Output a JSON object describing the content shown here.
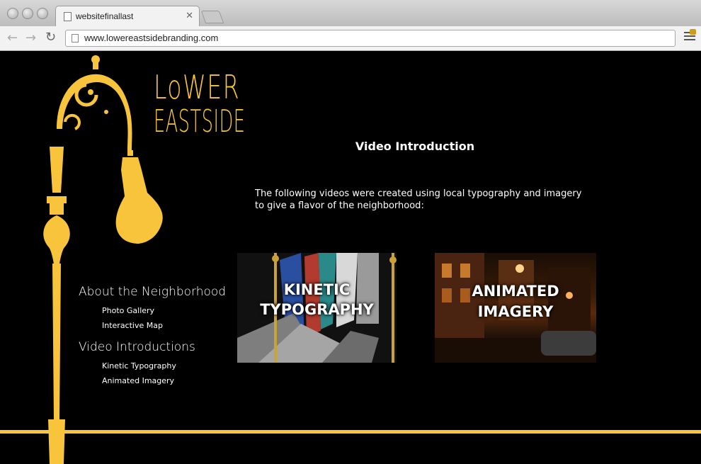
{
  "browser": {
    "tab_title": "websitefinallast",
    "url": "www.lowereastsidebranding.com"
  },
  "logo": {
    "line1": "LoWER",
    "line2": "EASTSIDE"
  },
  "content": {
    "title": "Video Introduction",
    "intro": "The following videos were created using local typography and imagery to give a flavor of the neighborhood:"
  },
  "nav": {
    "section1": "About the Neighborhood",
    "section1_items": [
      "Photo Gallery",
      "Interactive Map"
    ],
    "section2": "Video Introductions",
    "section2_items": [
      "Kinetic Typography",
      "Animated Imagery"
    ]
  },
  "thumbs": [
    {
      "line1": "KINETIC",
      "line2": "TYPOGRAPHY"
    },
    {
      "line1": "ANIMATED",
      "line2": "IMAGERY"
    }
  ],
  "colors": {
    "accent": "#f8c43c",
    "background": "#000000"
  }
}
